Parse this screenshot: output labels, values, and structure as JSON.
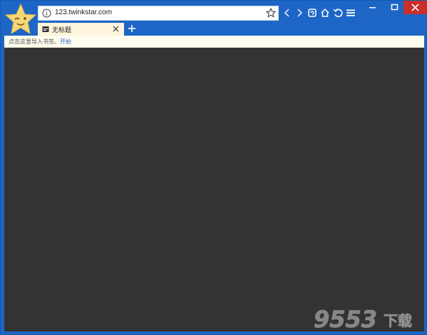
{
  "address": {
    "url": "123.twinkstar.com"
  },
  "tab": {
    "title": "无标题"
  },
  "bookmark_bar": {
    "hint": "点击这里导入书签。",
    "start_link": "开始"
  },
  "watermark": {
    "text": "9553",
    "suffix": "下载"
  },
  "icons": {
    "logo": "twinkstar-star-logo",
    "nav": [
      "back-icon",
      "forward-icon",
      "refresh-icon",
      "home-icon",
      "undo-icon",
      "menu-icon"
    ],
    "window": [
      "minimize-icon",
      "maximize-icon",
      "close-icon"
    ]
  },
  "colors": {
    "frame": "#1d66c6",
    "content": "#333333",
    "tab": "#fdf5dd",
    "link": "#2468d6",
    "close_hover": "#c9302c"
  }
}
